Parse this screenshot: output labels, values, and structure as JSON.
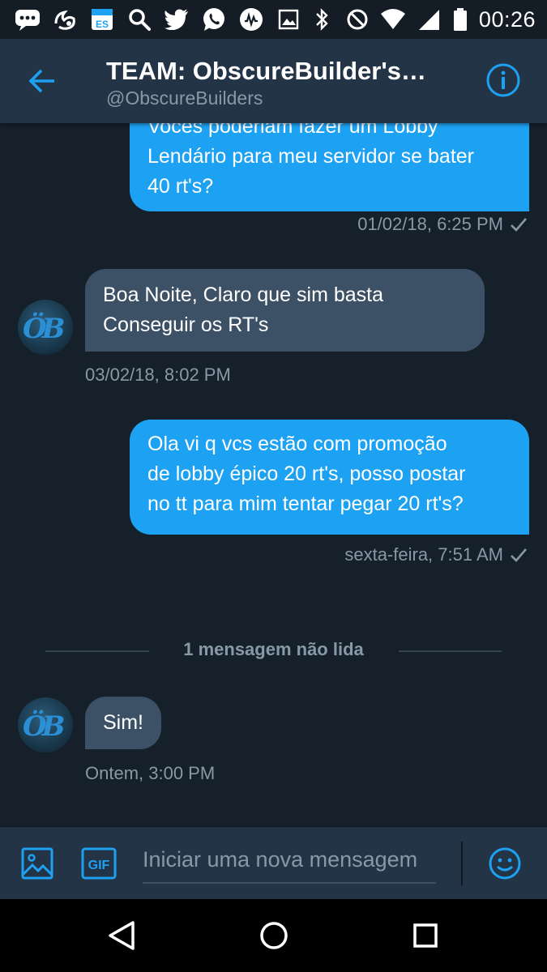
{
  "status_bar": {
    "time": "00:26",
    "left_icons": [
      "chat-bubble-icon",
      "uc-browser-icon",
      "es-file-icon",
      "search-icon",
      "twitter-icon",
      "whatsapp-icon",
      "musically-icon",
      "image-icon"
    ],
    "right_icons": [
      "bluetooth-icon",
      "do-not-disturb-icon",
      "wifi-icon",
      "signal-icon",
      "battery-icon"
    ]
  },
  "header": {
    "title": "TEAM: ObscureBuilder's…",
    "handle": "@ObscureBuilders"
  },
  "messages": [
    {
      "direction": "out",
      "text_lines": [
        "Vocês poderiam fazer um Lobby",
        "Lendário para meu servidor se bater",
        "40 rt's?"
      ],
      "meta": "01/02/18, 6:25 PM",
      "read": true
    },
    {
      "direction": "in",
      "text_lines": [
        "Boa Noite, Claro que sim basta",
        "Conseguir os RT's"
      ],
      "meta": "03/02/18, 8:02 PM"
    },
    {
      "direction": "out",
      "text_lines": [
        "Ola vi q vcs estão com promoção",
        "de lobby épico 20 rt's, posso postar",
        "no tt para mim tentar pegar 20 rt's?"
      ],
      "meta": "sexta-feira, 7:51 AM",
      "read": true
    },
    {
      "direction": "in",
      "text_lines": [
        "Sim!"
      ],
      "meta": "Ontem, 3:00 PM"
    }
  ],
  "unread_label": "1 mensagem não lida",
  "composer": {
    "placeholder": "Iniciar uma nova mensagem",
    "gif_label": "GIF"
  },
  "colors": {
    "background": "#15202b",
    "header": "#243447",
    "accent": "#1da1f2",
    "bubble_in": "#3d5166",
    "muted_text": "#8899a6"
  }
}
